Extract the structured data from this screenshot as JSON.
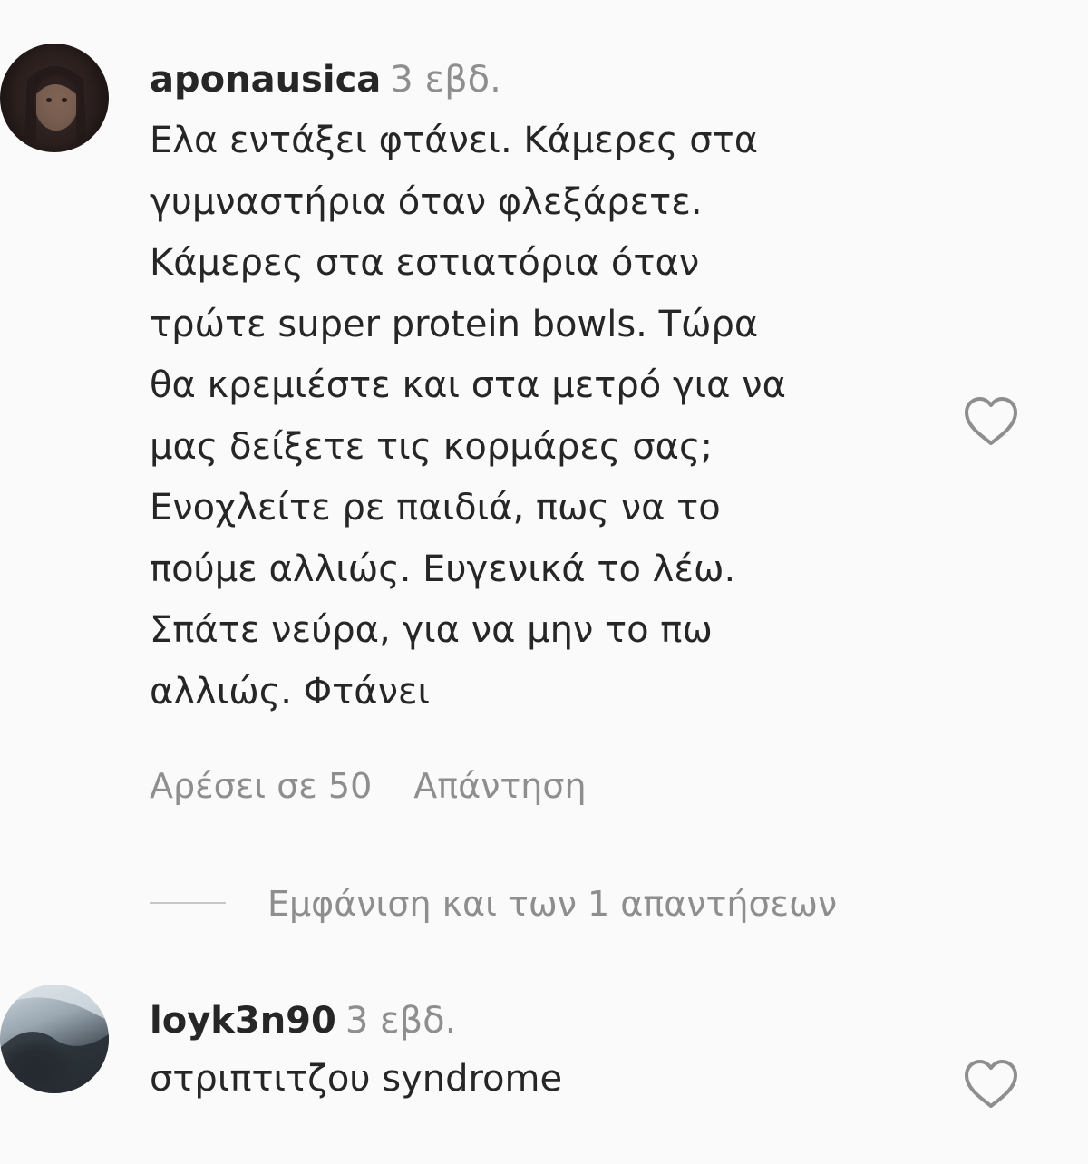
{
  "comments": [
    {
      "username": "aponausica",
      "timestamp": "3 εβδ.",
      "text": "Ελα εντάξει φτάνει. Κάμερες στα\nγυμναστήρια όταν φλεξάρετε.\nΚάμερες στα εστιατόρια όταν\nτρώτε super protein bowls. Τώρα\nθα κρεμιέστε και στα μετρό για να\nμας δείξετε τις κορμάρες σας;\nΕνοχλείτε ρε παιδιά, πως να το\nπούμε αλλιώς. Ευγενικά το λέω.\nΣπάτε νεύρα, για να μην το πω\nαλλιώς. Φτάνει",
      "likes_label": "Αρέσει σε 50",
      "reply_label": "Απάντηση",
      "view_replies_label": "Εμφάνιση και των 1 απαντήσεων",
      "avatar_icon": "profile-photo",
      "like_icon": "heart-outline-icon"
    },
    {
      "username": "loyk3n90",
      "timestamp": "3 εβδ.",
      "text": "στριπτιτζου syndrome",
      "avatar_icon": "profile-photo",
      "like_icon": "heart-outline-icon"
    }
  ],
  "colors": {
    "background": "#fafafa",
    "primary_text": "#262626",
    "secondary_text": "#8e8e8e",
    "divider": "#c7c7c7"
  }
}
